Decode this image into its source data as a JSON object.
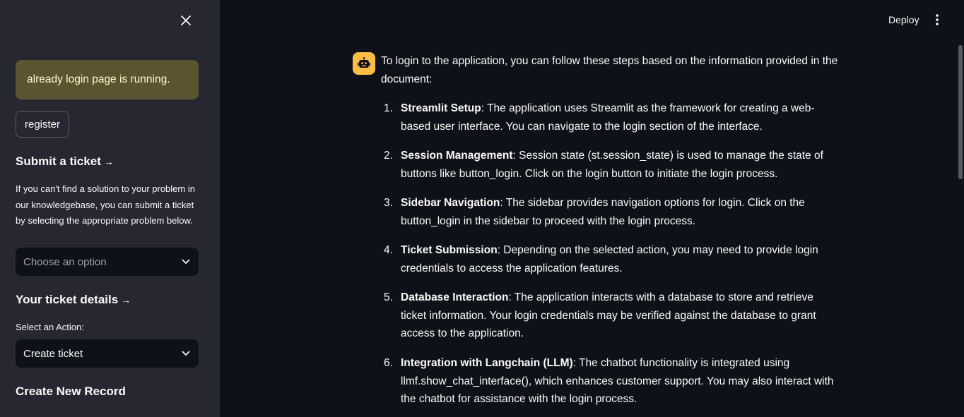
{
  "sidebar": {
    "alert_text": "already login page is running.",
    "register_label": "register",
    "submit_heading": "Submit a ticket",
    "submit_desc": "If you can't find a solution to your problem in our knowledgebase, you can submit a ticket by selecting the appropriate problem below.",
    "problem_select_placeholder": "Choose an option",
    "ticket_details_heading": "Your ticket details",
    "action_label": "Select an Action:",
    "action_select_value": "Create ticket",
    "create_record_heading": "Create New Record",
    "arrow_glyph": "→"
  },
  "header": {
    "deploy_label": "Deploy"
  },
  "chat": {
    "intro": "To login to the application, you can follow these steps based on the information provided in the document:",
    "steps": [
      {
        "num": "1.",
        "title": "Streamlit Setup",
        "text": ": The application uses Streamlit as the framework for creating a web-based user interface. You can navigate to the login section of the interface."
      },
      {
        "num": "2.",
        "title": "Session Management",
        "text": ": Session state (st.session_state) is used to manage the state of buttons like button_login. Click on the login button to initiate the login process."
      },
      {
        "num": "3.",
        "title": "Sidebar Navigation",
        "text": ": The sidebar provides navigation options for login. Click on the button_login in the sidebar to proceed with the login process."
      },
      {
        "num": "4.",
        "title": "Ticket Submission",
        "text": ": Depending on the selected action, you may need to provide login credentials to access the application features."
      },
      {
        "num": "5.",
        "title": "Database Interaction",
        "text": ": The application interacts with a database to store and retrieve ticket information. Your login credentials may be verified against the database to grant access to the application."
      },
      {
        "num": "6.",
        "title": "Integration with Langchain (LLM)",
        "text": ": The chatbot functionality is integrated using llmf.show_chat_interface(), which enhances customer support. You may also interact with the chatbot for assistance with the login process."
      }
    ]
  },
  "icons": {
    "close": "close-icon",
    "chevron": "chevron-down-icon",
    "menu": "more-vertical-icon",
    "avatar": "bot-icon"
  },
  "colors": {
    "sidebar_bg": "#262730",
    "main_bg": "#0e1117",
    "alert_bg": "#5a5430",
    "alert_text": "#fffac8",
    "avatar_bg": "#ffbd45"
  }
}
